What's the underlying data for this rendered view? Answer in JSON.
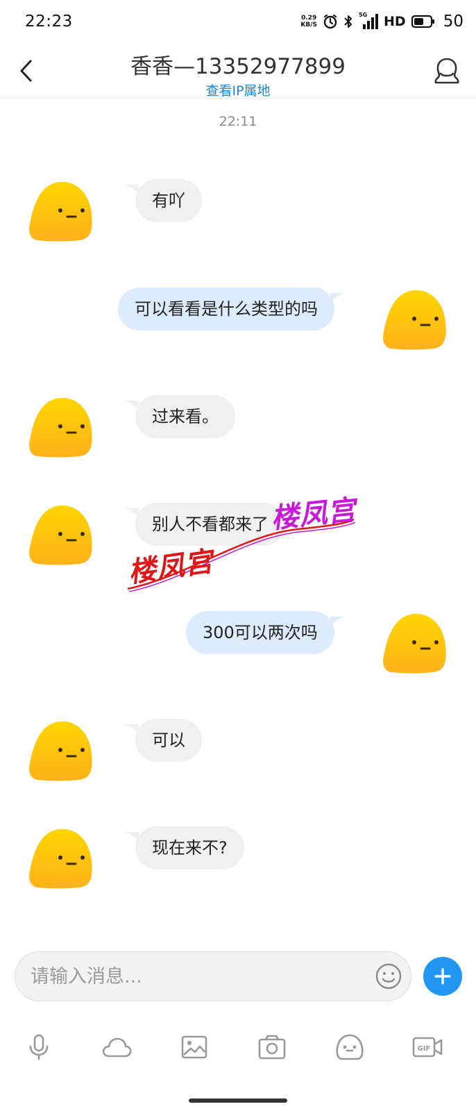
{
  "status_bar": {
    "time": "22:23",
    "net_speed_value": "0.29",
    "net_speed_unit": "KB/S",
    "network_type": "5G",
    "hd_label": "HD",
    "battery_level": "50"
  },
  "header": {
    "title": "香香—13352977899",
    "subtitle_link": "查看IP属地"
  },
  "chat": {
    "timestamp": "22:11",
    "messages": [
      {
        "direction": "incoming",
        "text": "有吖"
      },
      {
        "direction": "outgoing",
        "text": "可以看看是什么类型的吗"
      },
      {
        "direction": "incoming",
        "text": "过来看。"
      },
      {
        "direction": "incoming",
        "text": "别人不看都来了"
      },
      {
        "direction": "outgoing",
        "text": "300可以两次吗"
      },
      {
        "direction": "incoming",
        "text": "可以"
      },
      {
        "direction": "incoming",
        "text": "现在来不?"
      }
    ]
  },
  "watermark": {
    "text_top": "楼凤宫",
    "text_bottom": "楼凤宫",
    "color_top": "#c81ad6",
    "color_bottom": "#e01616"
  },
  "input": {
    "placeholder": "请输入消息..."
  },
  "toolbar": {
    "items": [
      "microphone-icon",
      "cloud-icon",
      "image-icon",
      "camera-icon",
      "sticker-icon",
      "gif-icon"
    ]
  },
  "colors": {
    "accent": "#2196f3",
    "link": "#1a86d9",
    "incoming_bubble": "#f0f0f0",
    "outgoing_bubble": "#dcecfc",
    "avatar_top": "#ffd600",
    "avatar_bottom": "#ffb11b"
  }
}
